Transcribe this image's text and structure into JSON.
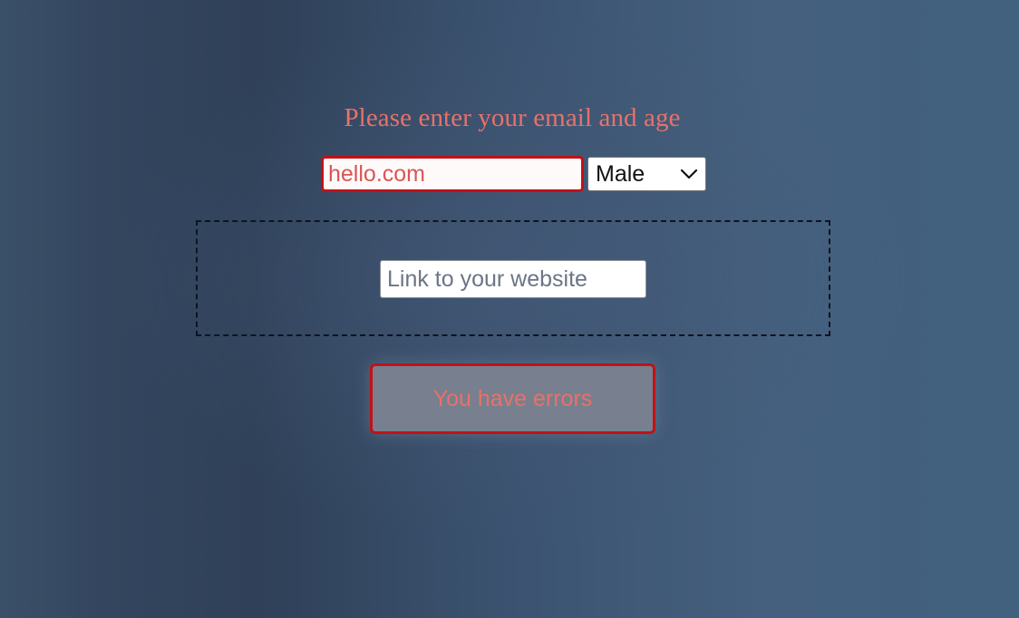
{
  "form": {
    "title": "Please enter your email and age",
    "email": {
      "value": "hello.com",
      "placeholder": ""
    },
    "gender_select": {
      "selected": "Male"
    },
    "website": {
      "value": "",
      "placeholder": "Link to your website"
    },
    "submit_button_label": "You have errors"
  },
  "colors": {
    "error": "#c41016",
    "error_text": "#e8716a",
    "disabled_button_bg": "#787f8f"
  },
  "icons": {
    "select_arrow": "chevron-down-icon"
  }
}
